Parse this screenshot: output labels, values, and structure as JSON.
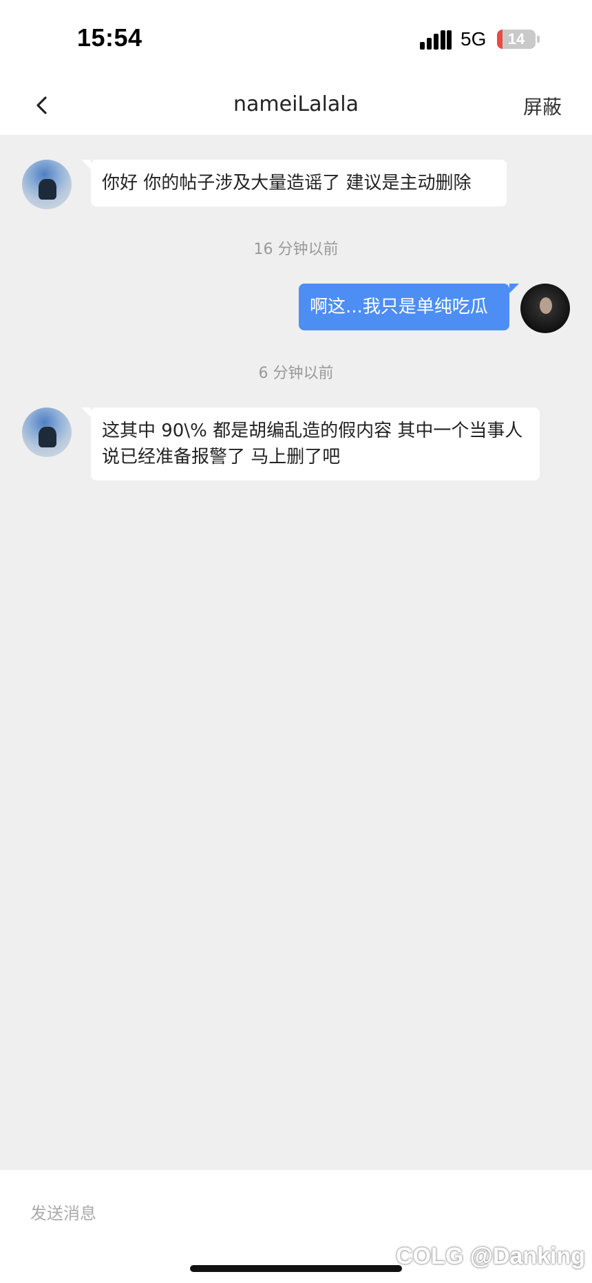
{
  "status_bar": {
    "time": "15:54",
    "network": "5G",
    "battery": "14",
    "battery_level": 0.14
  },
  "header": {
    "title": "nameiLalala",
    "action": "屏蔽"
  },
  "messages": [
    {
      "side": "left",
      "text": "你好 你的帖子涉及大量造谣了 建议是主动删除"
    },
    {
      "type": "timestamp",
      "text": "16 分钟以前"
    },
    {
      "side": "right",
      "text": "啊这...我只是单纯吃瓜"
    },
    {
      "type": "timestamp",
      "text": "6 分钟以前"
    },
    {
      "side": "left",
      "text": "这其中 90\\% 都是胡编乱造的假内容  其中一个当事人说已经准备报警了 马上删了吧"
    }
  ],
  "composer": {
    "placeholder": "发送消息"
  },
  "watermark": "COLG @Danking",
  "colors": {
    "outgoing_bubble": "#4d8ef5",
    "incoming_bubble": "#ffffff",
    "chat_background": "#efefef"
  }
}
